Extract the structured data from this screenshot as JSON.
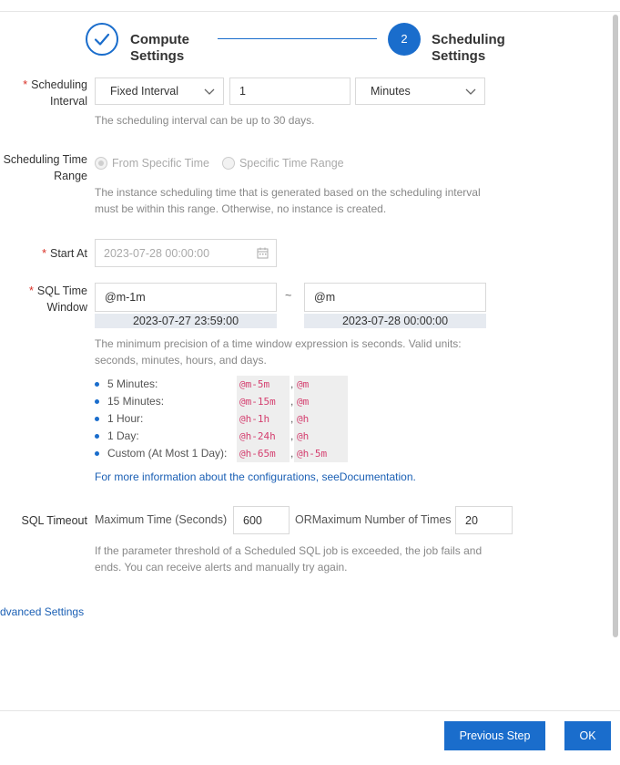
{
  "steps": {
    "step1": {
      "title_line1": "Compute",
      "title_line2": "Settings"
    },
    "step2": {
      "number": "2",
      "title_line1": "Scheduling",
      "title_line2": "Settings"
    }
  },
  "scheduling_interval": {
    "label_line1": "Scheduling",
    "label_line2": "Interval",
    "mode": "Fixed Interval",
    "value": "1",
    "unit": "Minutes",
    "hint": "The scheduling interval can be up to 30 days."
  },
  "time_range": {
    "label_line1": "Scheduling Time",
    "label_line2": "Range",
    "option1": "From Specific Time",
    "option2": "Specific Time Range",
    "hint_line1": "The instance scheduling time that is generated based on the scheduling interval",
    "hint_line2": "must be within this range. Otherwise, no instance is created."
  },
  "start_at": {
    "label": "Start At",
    "placeholder": "2023-07-28 00:00:00"
  },
  "sql_window": {
    "label_line1": "SQL Time",
    "label_line2": "Window",
    "start": "@m-1m",
    "separator": "~",
    "end": "@m",
    "start_preview": "2023-07-27 23:59:00",
    "end_preview": "2023-07-28 00:00:00",
    "hint_line1": "The minimum precision of a time window expression is seconds. Valid units:",
    "hint_line2": "seconds, minutes, hours, and days.",
    "examples": [
      {
        "label": "5 Minutes:",
        "from": "@m-5m",
        "to": "@m"
      },
      {
        "label": "15 Minutes:",
        "from": "@m-15m",
        "to": "@m"
      },
      {
        "label": "1 Hour:",
        "from": "@h-1h",
        "to": "@h"
      },
      {
        "label": "1 Day:",
        "from": "@h-24h",
        "to": "@h"
      },
      {
        "label": "Custom (At Most 1 Day):",
        "from": "@h-65m",
        "to": "@h-5m"
      }
    ],
    "more_info": "For more information about the configurations, seeDocumentation."
  },
  "timeout": {
    "label": "SQL Timeout",
    "max_time_label": "Maximum Time (Seconds)",
    "max_time_value": "600",
    "max_times_label": "ORMaximum Number of Times",
    "max_times_value": "20",
    "hint_line1": "If the parameter threshold of a Scheduled SQL job is exceeded, the job fails and",
    "hint_line2": "ends. You can receive alerts and manually try again."
  },
  "advanced_settings": "dvanced Settings",
  "footer": {
    "previous": "Previous Step",
    "ok": "OK"
  },
  "colors": {
    "primary": "#1a6dcc",
    "code_text": "#d43f6f",
    "required": "#d93026"
  }
}
